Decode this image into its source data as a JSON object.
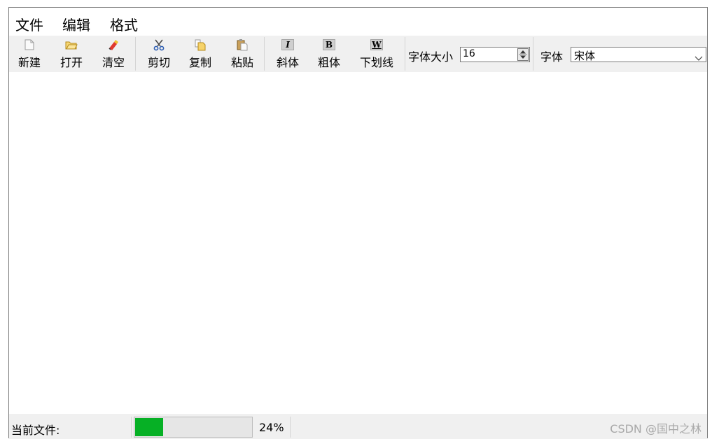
{
  "menubar": {
    "items": [
      "文件",
      "编辑",
      "格式"
    ]
  },
  "toolbar": {
    "new_label": "新建",
    "open_label": "打开",
    "clear_label": "清空",
    "cut_label": "剪切",
    "copy_label": "复制",
    "paste_label": "粘贴",
    "italic_label": "斜体",
    "italic_glyph": "I",
    "bold_label": "粗体",
    "bold_glyph": "B",
    "underline_label": "下划线",
    "underline_glyph": "W",
    "font_size_label": "字体大小",
    "font_size_value": "16",
    "font_label": "字体",
    "font_value": "宋体",
    "icons": [
      "new-file-icon",
      "open-folder-icon",
      "eraser-icon",
      "scissors-icon",
      "copy-icon",
      "paste-icon",
      "italic-icon",
      "bold-icon",
      "underline-icon"
    ]
  },
  "status": {
    "current_file_label": "当前文件:",
    "progress_percent": 24,
    "progress_text": "24%"
  },
  "watermark": "CSDN @国中之林",
  "colors": {
    "progress": "#06b025",
    "toolbar_bg": "#f0f0f0"
  }
}
